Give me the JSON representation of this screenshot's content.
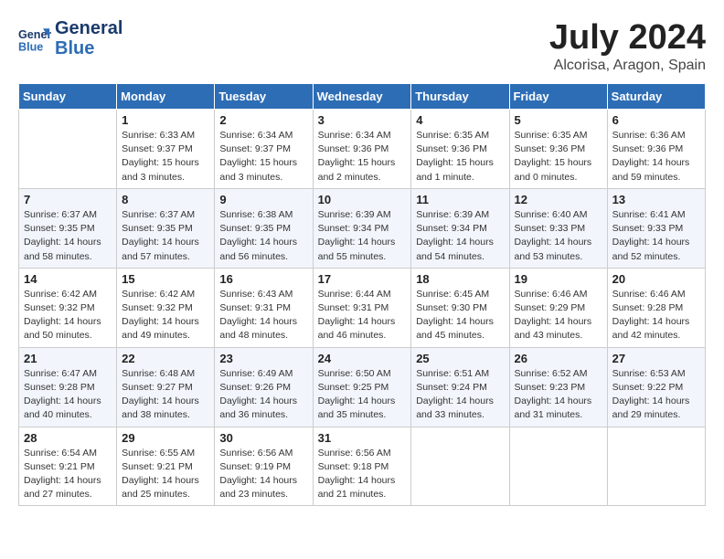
{
  "header": {
    "logo_line1": "General",
    "logo_line2": "Blue",
    "month": "July 2024",
    "location": "Alcorisa, Aragon, Spain"
  },
  "weekdays": [
    "Sunday",
    "Monday",
    "Tuesday",
    "Wednesday",
    "Thursday",
    "Friday",
    "Saturday"
  ],
  "weeks": [
    [
      {
        "day": "",
        "info": ""
      },
      {
        "day": "1",
        "info": "Sunrise: 6:33 AM\nSunset: 9:37 PM\nDaylight: 15 hours\nand 3 minutes."
      },
      {
        "day": "2",
        "info": "Sunrise: 6:34 AM\nSunset: 9:37 PM\nDaylight: 15 hours\nand 3 minutes."
      },
      {
        "day": "3",
        "info": "Sunrise: 6:34 AM\nSunset: 9:36 PM\nDaylight: 15 hours\nand 2 minutes."
      },
      {
        "day": "4",
        "info": "Sunrise: 6:35 AM\nSunset: 9:36 PM\nDaylight: 15 hours\nand 1 minute."
      },
      {
        "day": "5",
        "info": "Sunrise: 6:35 AM\nSunset: 9:36 PM\nDaylight: 15 hours\nand 0 minutes."
      },
      {
        "day": "6",
        "info": "Sunrise: 6:36 AM\nSunset: 9:36 PM\nDaylight: 14 hours\nand 59 minutes."
      }
    ],
    [
      {
        "day": "7",
        "info": "Sunrise: 6:37 AM\nSunset: 9:35 PM\nDaylight: 14 hours\nand 58 minutes."
      },
      {
        "day": "8",
        "info": "Sunrise: 6:37 AM\nSunset: 9:35 PM\nDaylight: 14 hours\nand 57 minutes."
      },
      {
        "day": "9",
        "info": "Sunrise: 6:38 AM\nSunset: 9:35 PM\nDaylight: 14 hours\nand 56 minutes."
      },
      {
        "day": "10",
        "info": "Sunrise: 6:39 AM\nSunset: 9:34 PM\nDaylight: 14 hours\nand 55 minutes."
      },
      {
        "day": "11",
        "info": "Sunrise: 6:39 AM\nSunset: 9:34 PM\nDaylight: 14 hours\nand 54 minutes."
      },
      {
        "day": "12",
        "info": "Sunrise: 6:40 AM\nSunset: 9:33 PM\nDaylight: 14 hours\nand 53 minutes."
      },
      {
        "day": "13",
        "info": "Sunrise: 6:41 AM\nSunset: 9:33 PM\nDaylight: 14 hours\nand 52 minutes."
      }
    ],
    [
      {
        "day": "14",
        "info": "Sunrise: 6:42 AM\nSunset: 9:32 PM\nDaylight: 14 hours\nand 50 minutes."
      },
      {
        "day": "15",
        "info": "Sunrise: 6:42 AM\nSunset: 9:32 PM\nDaylight: 14 hours\nand 49 minutes."
      },
      {
        "day": "16",
        "info": "Sunrise: 6:43 AM\nSunset: 9:31 PM\nDaylight: 14 hours\nand 48 minutes."
      },
      {
        "day": "17",
        "info": "Sunrise: 6:44 AM\nSunset: 9:31 PM\nDaylight: 14 hours\nand 46 minutes."
      },
      {
        "day": "18",
        "info": "Sunrise: 6:45 AM\nSunset: 9:30 PM\nDaylight: 14 hours\nand 45 minutes."
      },
      {
        "day": "19",
        "info": "Sunrise: 6:46 AM\nSunset: 9:29 PM\nDaylight: 14 hours\nand 43 minutes."
      },
      {
        "day": "20",
        "info": "Sunrise: 6:46 AM\nSunset: 9:28 PM\nDaylight: 14 hours\nand 42 minutes."
      }
    ],
    [
      {
        "day": "21",
        "info": "Sunrise: 6:47 AM\nSunset: 9:28 PM\nDaylight: 14 hours\nand 40 minutes."
      },
      {
        "day": "22",
        "info": "Sunrise: 6:48 AM\nSunset: 9:27 PM\nDaylight: 14 hours\nand 38 minutes."
      },
      {
        "day": "23",
        "info": "Sunrise: 6:49 AM\nSunset: 9:26 PM\nDaylight: 14 hours\nand 36 minutes."
      },
      {
        "day": "24",
        "info": "Sunrise: 6:50 AM\nSunset: 9:25 PM\nDaylight: 14 hours\nand 35 minutes."
      },
      {
        "day": "25",
        "info": "Sunrise: 6:51 AM\nSunset: 9:24 PM\nDaylight: 14 hours\nand 33 minutes."
      },
      {
        "day": "26",
        "info": "Sunrise: 6:52 AM\nSunset: 9:23 PM\nDaylight: 14 hours\nand 31 minutes."
      },
      {
        "day": "27",
        "info": "Sunrise: 6:53 AM\nSunset: 9:22 PM\nDaylight: 14 hours\nand 29 minutes."
      }
    ],
    [
      {
        "day": "28",
        "info": "Sunrise: 6:54 AM\nSunset: 9:21 PM\nDaylight: 14 hours\nand 27 minutes."
      },
      {
        "day": "29",
        "info": "Sunrise: 6:55 AM\nSunset: 9:21 PM\nDaylight: 14 hours\nand 25 minutes."
      },
      {
        "day": "30",
        "info": "Sunrise: 6:56 AM\nSunset: 9:19 PM\nDaylight: 14 hours\nand 23 minutes."
      },
      {
        "day": "31",
        "info": "Sunrise: 6:56 AM\nSunset: 9:18 PM\nDaylight: 14 hours\nand 21 minutes."
      },
      {
        "day": "",
        "info": ""
      },
      {
        "day": "",
        "info": ""
      },
      {
        "day": "",
        "info": ""
      }
    ]
  ]
}
